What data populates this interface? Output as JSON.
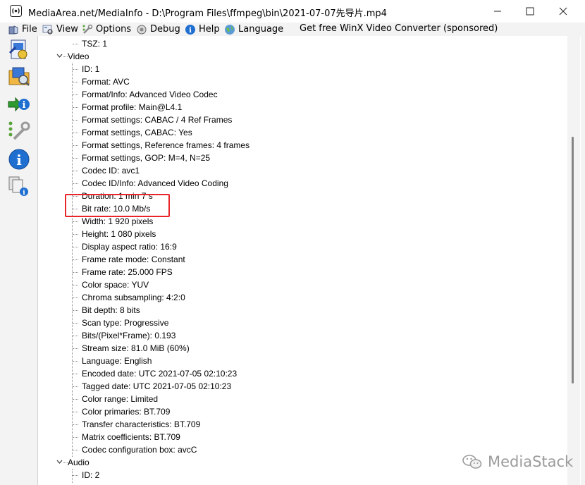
{
  "window": {
    "title": "MediaArea.net/MediaInfo - D:\\Program Files\\ffmpeg\\bin\\2021-07-07先导片.mp4",
    "controls": [
      "minimize",
      "maximize",
      "close"
    ]
  },
  "menu": {
    "file": "File",
    "view": "View",
    "options": "Options",
    "debug": "Debug",
    "help": "Help",
    "language": "Language",
    "sponsor": "Get free WinX Video Converter (sponsored)"
  },
  "toolbar": {
    "icons": [
      "open-file-icon",
      "open-folder-icon",
      "export-icon",
      "preferences-icon",
      "about-icon",
      "knowledge-base-icon"
    ]
  },
  "tree": {
    "top_item": "TSZ: 1",
    "video_section": "Video",
    "video_items": [
      "ID: 1",
      "Format: AVC",
      "Format/Info: Advanced Video Codec",
      "Format profile: Main@L4.1",
      "Format settings: CABAC / 4 Ref Frames",
      "Format settings, CABAC: Yes",
      "Format settings, Reference frames: 4 frames",
      "Format settings, GOP: M=4, N=25",
      "Codec ID: avc1",
      "Codec ID/Info: Advanced Video Coding",
      "Duration: 1 min 7 s",
      "Bit rate: 10.0 Mb/s",
      "Width: 1 920 pixels",
      "Height: 1 080 pixels",
      "Display aspect ratio: 16:9",
      "Frame rate mode: Constant",
      "Frame rate: 25.000 FPS",
      "Color space: YUV",
      "Chroma subsampling: 4:2:0",
      "Bit depth: 8 bits",
      "Scan type: Progressive",
      "Bits/(Pixel*Frame): 0.193",
      "Stream size: 81.0 MiB (60%)",
      "Language: English",
      "Encoded date: UTC 2021-07-05 02:10:23",
      "Tagged date: UTC 2021-07-05 02:10:23",
      "Color range: Limited",
      "Color primaries: BT.709",
      "Transfer characteristics: BT.709",
      "Matrix coefficients: BT.709",
      "Codec configuration box: avcC"
    ],
    "audio_section": "Audio",
    "audio_items": [
      "ID: 2"
    ]
  },
  "highlight": {
    "target": "Bit rate: 10.0 Mb/s",
    "color": "#e8262a"
  },
  "watermark": {
    "text": "MediaStack"
  }
}
